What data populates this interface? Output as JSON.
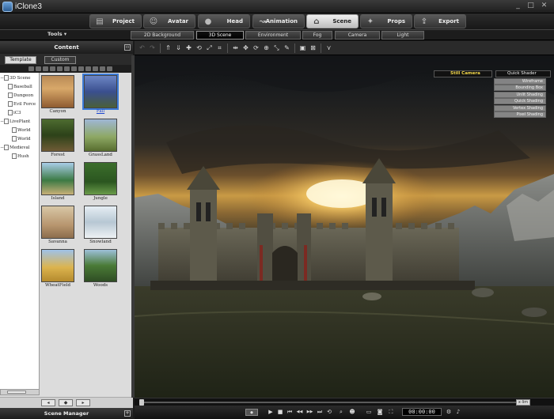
{
  "window": {
    "title": "iClone3",
    "min_label": "_",
    "max_label": "□",
    "close_label": "✕"
  },
  "main_tabs": [
    {
      "label": "Project",
      "icon": "project-icon",
      "glyph": "▤"
    },
    {
      "label": "Avatar",
      "icon": "avatar-icon",
      "glyph": "☺"
    },
    {
      "label": "Head",
      "icon": "head-icon",
      "glyph": "●"
    },
    {
      "label": "Animation",
      "icon": "animation-icon",
      "glyph": "↝"
    },
    {
      "label": "Scene",
      "icon": "scene-icon",
      "glyph": "⌂"
    },
    {
      "label": "Props",
      "icon": "props-icon",
      "glyph": "✦"
    },
    {
      "label": "Export",
      "icon": "export-icon",
      "glyph": "⇪"
    }
  ],
  "active_main_tab": "Scene",
  "tools_menu": "Tools ▾",
  "sub_tabs": [
    "2D Background",
    "3D Scene",
    "Environment",
    "Fog",
    "Camera",
    "Light"
  ],
  "active_sub_tab": "3D Scene",
  "content_panel": {
    "title": "Content",
    "tabs": [
      "Template",
      "Custom"
    ],
    "active_tab": "Template",
    "tree": [
      {
        "label": "3D Scene",
        "level": 0,
        "expander": "−"
      },
      {
        "label": "Baseball",
        "level": 1,
        "expander": ""
      },
      {
        "label": "Dungeon",
        "level": 1,
        "expander": ""
      },
      {
        "label": "Evil Force",
        "level": 1,
        "expander": ""
      },
      {
        "label": "iC3",
        "level": 1,
        "expander": ""
      },
      {
        "label": "LivePlant",
        "level": 0,
        "expander": "−"
      },
      {
        "label": "World",
        "level": 2,
        "expander": ""
      },
      {
        "label": "World",
        "level": 2,
        "expander": ""
      },
      {
        "label": "Medieval",
        "level": 0,
        "expander": "−"
      },
      {
        "label": "Hush",
        "level": 2,
        "expander": ""
      }
    ],
    "thumbnails": [
      {
        "label": "Canyon",
        "selected": false
      },
      {
        "label": "Fall",
        "selected": true
      },
      {
        "label": "Forest",
        "selected": false
      },
      {
        "label": "GrassLand",
        "selected": false
      },
      {
        "label": "Island",
        "selected": false
      },
      {
        "label": "Jungle",
        "selected": false
      },
      {
        "label": "Savanna",
        "selected": false
      },
      {
        "label": "Snowland",
        "selected": false
      },
      {
        "label": "WheatField",
        "selected": false
      },
      {
        "label": "Woods",
        "selected": false
      }
    ],
    "footer_buttons": [
      "◂",
      "◆",
      "▸"
    ],
    "scene_manager_label": "Scene Manager",
    "scene_manager_button": "+"
  },
  "viewport": {
    "camera": "Still Camera",
    "shader": "Quick Shader",
    "shader_options": [
      "Wireframe",
      "Bounding Box",
      "Unlit Shading",
      "Quick Shading",
      "Vertex Shading",
      "Pixel Shading"
    ],
    "toolbar_icons": [
      {
        "name": "undo-icon",
        "glyph": "↶"
      },
      {
        "name": "redo-icon",
        "glyph": "↷"
      },
      {
        "name": "sep",
        "glyph": ""
      },
      {
        "name": "pick-parent-icon",
        "glyph": "⇑"
      },
      {
        "name": "pick-child-icon",
        "glyph": "⇓"
      },
      {
        "name": "move-icon",
        "glyph": "✚"
      },
      {
        "name": "rotate-icon",
        "glyph": "⟲"
      },
      {
        "name": "scale-icon",
        "glyph": "⤢"
      },
      {
        "name": "frame-icon",
        "glyph": "⌗"
      },
      {
        "name": "sep",
        "glyph": ""
      },
      {
        "name": "align-icon",
        "glyph": "⇹"
      },
      {
        "name": "pan-icon",
        "glyph": "✥"
      },
      {
        "name": "orbit-icon",
        "glyph": "⟳"
      },
      {
        "name": "zoom-icon",
        "glyph": "⊕"
      },
      {
        "name": "fit-icon",
        "glyph": "⤡"
      },
      {
        "name": "draw-icon",
        "glyph": "✎"
      },
      {
        "name": "sep",
        "glyph": ""
      },
      {
        "name": "view-all-icon",
        "glyph": "▣"
      },
      {
        "name": "view-selected-icon",
        "glyph": "⊠"
      },
      {
        "name": "sep",
        "glyph": ""
      },
      {
        "name": "snap-icon",
        "glyph": "⋎"
      }
    ]
  },
  "timeline": {
    "mode_label": "x·lim"
  },
  "playback": {
    "controls": [
      {
        "name": "record-mode-icon",
        "glyph": "⏺"
      },
      {
        "name": "play-icon",
        "glyph": "▶"
      },
      {
        "name": "stop-icon",
        "glyph": "■"
      },
      {
        "name": "prev-key-icon",
        "glyph": "⏮"
      },
      {
        "name": "rewind-icon",
        "glyph": "◀◀"
      },
      {
        "name": "forward-icon",
        "glyph": "▶▶"
      },
      {
        "name": "next-key-icon",
        "glyph": "⏭"
      },
      {
        "name": "loop-icon",
        "glyph": "⟲"
      },
      {
        "name": "zoom-view-icon",
        "glyph": "⌕"
      },
      {
        "name": "character-icon",
        "glyph": "☻"
      },
      {
        "name": "layout-icon",
        "glyph": "▭"
      },
      {
        "name": "camera-icon",
        "glyph": "◙"
      },
      {
        "name": "fullscreen-icon",
        "glyph": "⛶"
      }
    ],
    "timecode": "00:00:00",
    "extra_icons": [
      {
        "name": "settings-icon",
        "glyph": "⚙"
      },
      {
        "name": "speaker-icon",
        "glyph": "♪"
      }
    ]
  }
}
